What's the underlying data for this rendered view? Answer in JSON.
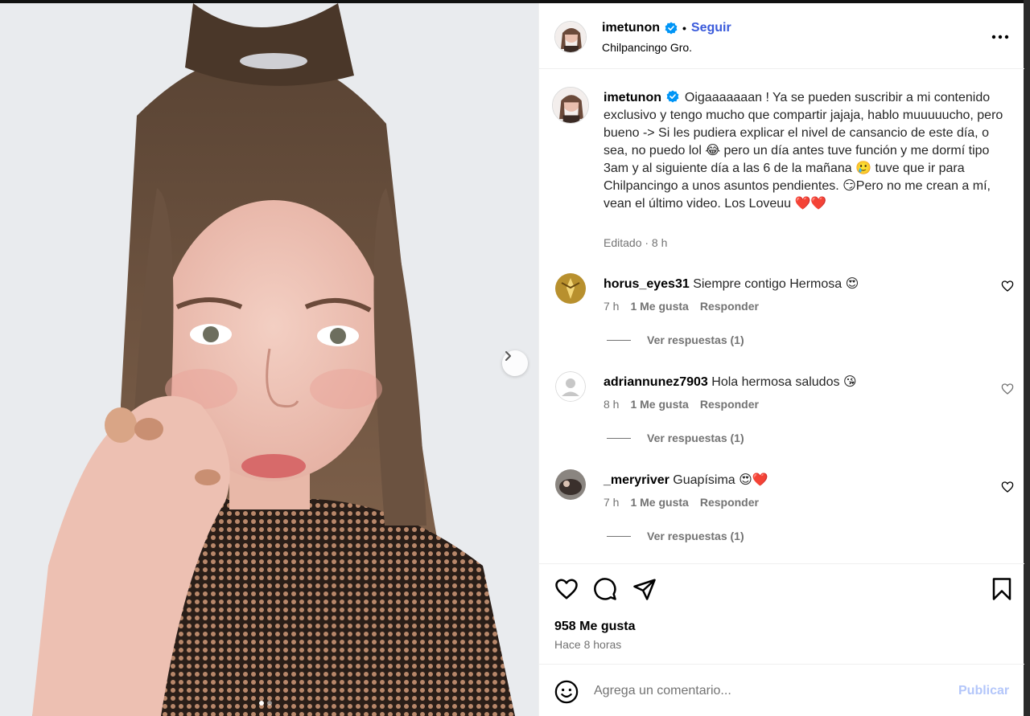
{
  "post": {
    "username": "imetunon",
    "follow_label": "Seguir",
    "separator": "•",
    "location": "Chilpancingo Gro.",
    "caption_text": "Oigaaaaaaan ! Ya se pueden suscribir a mi contenido exclusivo y tengo mucho que compartir jajaja, hablo muuuuucho, pero bueno -> Si les pudiera explicar el nivel de cansancio de este día, o sea, no puedo lol 😂 pero un día antes tuve función y me dormí tipo 3am y al siguiente día a las 6 de la mañana 🥲 tuve que ir para Chilpancingo a unos asuntos pendientes. 😏Pero no me crean a mí, vean el último video. Los Loveuu ❤️❤️",
    "caption_meta": "Editado · 8 h",
    "likes": "958 Me gusta",
    "time_ago": "Hace 8 horas",
    "verified_color": "#0095f6"
  },
  "comments": [
    {
      "username": "horus_eyes31",
      "text": "Siempre contigo Hermosa 😍",
      "time": "7 h",
      "likes": "1 Me gusta",
      "reply_label": "Responder",
      "view_replies": "Ver respuestas (1)"
    },
    {
      "username": "adriannunez7903",
      "text": "Hola hermosa saludos 😘",
      "time": "8 h",
      "likes": "1 Me gusta",
      "reply_label": "Responder",
      "view_replies": "Ver respuestas (1)"
    },
    {
      "username": "_meryriver",
      "text": "Guapísima 😍❤️",
      "time": "7 h",
      "likes": "1 Me gusta",
      "reply_label": "Responder",
      "view_replies": "Ver respuestas (1)"
    }
  ],
  "composer": {
    "placeholder": "Agrega un comentario...",
    "publish_label": "Publicar"
  },
  "icons": {
    "more": "more-options-icon",
    "like": "heart-icon",
    "comment": "comment-icon",
    "share": "send-icon",
    "save": "bookmark-icon",
    "emoji": "emoji-icon",
    "next": "chevron-right-icon"
  },
  "colors": {
    "accent": "#3b5bdb",
    "publish_disabled": "#b3c6fa",
    "secondary_text": "#737373"
  }
}
